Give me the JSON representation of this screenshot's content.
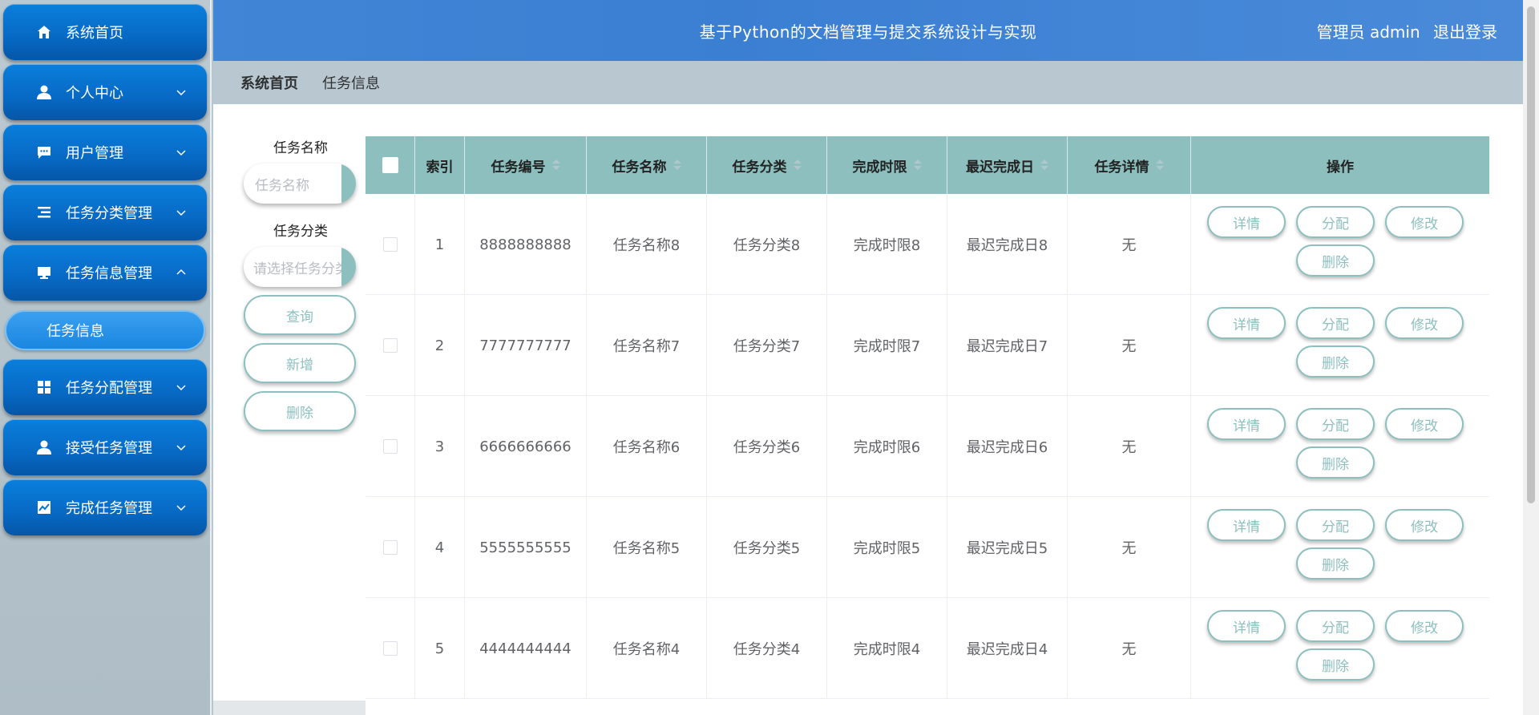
{
  "sidebar": {
    "items": [
      {
        "label": "系统首页",
        "icon": "home-icon",
        "chevron": ""
      },
      {
        "label": "个人中心",
        "icon": "user-icon",
        "chevron": "down"
      },
      {
        "label": "用户管理",
        "icon": "chat-icon",
        "chevron": "down"
      },
      {
        "label": "任务分类管理",
        "icon": "list-icon",
        "chevron": "down"
      },
      {
        "label": "任务信息管理",
        "icon": "monitor-icon",
        "chevron": "up"
      },
      {
        "label": "任务分配管理",
        "icon": "grid-icon",
        "chevron": "down"
      },
      {
        "label": "接受任务管理",
        "icon": "user-icon",
        "chevron": "down"
      },
      {
        "label": "完成任务管理",
        "icon": "chart-icon",
        "chevron": "down"
      }
    ],
    "active_sub": "任务信息"
  },
  "header": {
    "title": "基于Python的文档管理与提交系统设计与实现",
    "role": "管理员 admin",
    "logout": "退出登录"
  },
  "breadcrumb": {
    "home": "系统首页",
    "current": "任务信息"
  },
  "search": {
    "name_label": "任务名称",
    "name_placeholder": "任务名称",
    "category_label": "任务分类",
    "category_placeholder": "请选择任务分类",
    "query": "查询",
    "add": "新增",
    "delete": "删除"
  },
  "table": {
    "headers": [
      "索引",
      "任务编号",
      "任务名称",
      "任务分类",
      "完成时限",
      "最迟完成日",
      "任务详情",
      "操作"
    ],
    "rows": [
      {
        "index": "1",
        "code": "8888888888",
        "name": "任务名称8",
        "category": "任务分类8",
        "limit": "完成时限8",
        "latest": "最迟完成日8",
        "detail": "无"
      },
      {
        "index": "2",
        "code": "7777777777",
        "name": "任务名称7",
        "category": "任务分类7",
        "limit": "完成时限7",
        "latest": "最迟完成日7",
        "detail": "无"
      },
      {
        "index": "3",
        "code": "6666666666",
        "name": "任务名称6",
        "category": "任务分类6",
        "limit": "完成时限6",
        "latest": "最迟完成日6",
        "detail": "无"
      },
      {
        "index": "4",
        "code": "5555555555",
        "name": "任务名称5",
        "category": "任务分类5",
        "limit": "完成时限5",
        "latest": "最迟完成日5",
        "detail": "无"
      },
      {
        "index": "5",
        "code": "4444444444",
        "name": "任务名称4",
        "category": "任务分类4",
        "limit": "完成时限4",
        "latest": "最迟完成日4",
        "detail": "无"
      }
    ],
    "actions": {
      "detail": "详情",
      "assign": "分配",
      "edit": "修改",
      "delete": "删除"
    }
  },
  "colors": {
    "accent": "#8dbfbf",
    "header": "#3f83d5",
    "menu": "#0a73d2"
  }
}
